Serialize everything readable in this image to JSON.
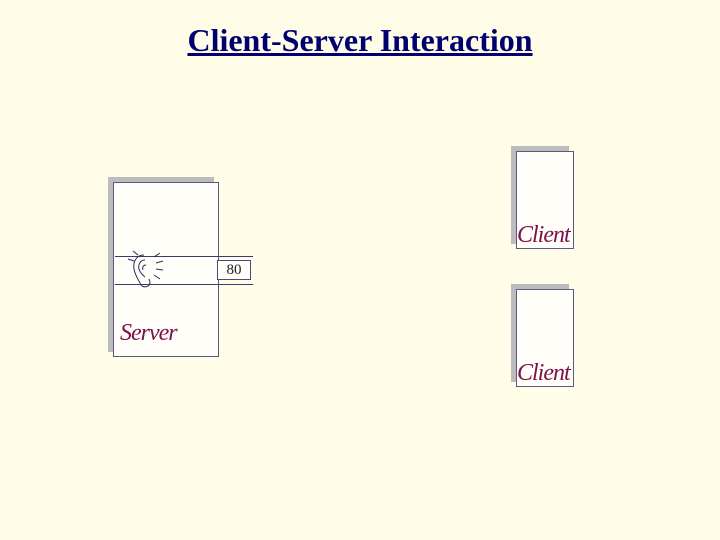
{
  "title": "Client-Server Interaction",
  "server": {
    "label": "Server",
    "port": "80",
    "icon": "ear-icon"
  },
  "clients": [
    {
      "label": "Client"
    },
    {
      "label": "Client"
    }
  ]
}
